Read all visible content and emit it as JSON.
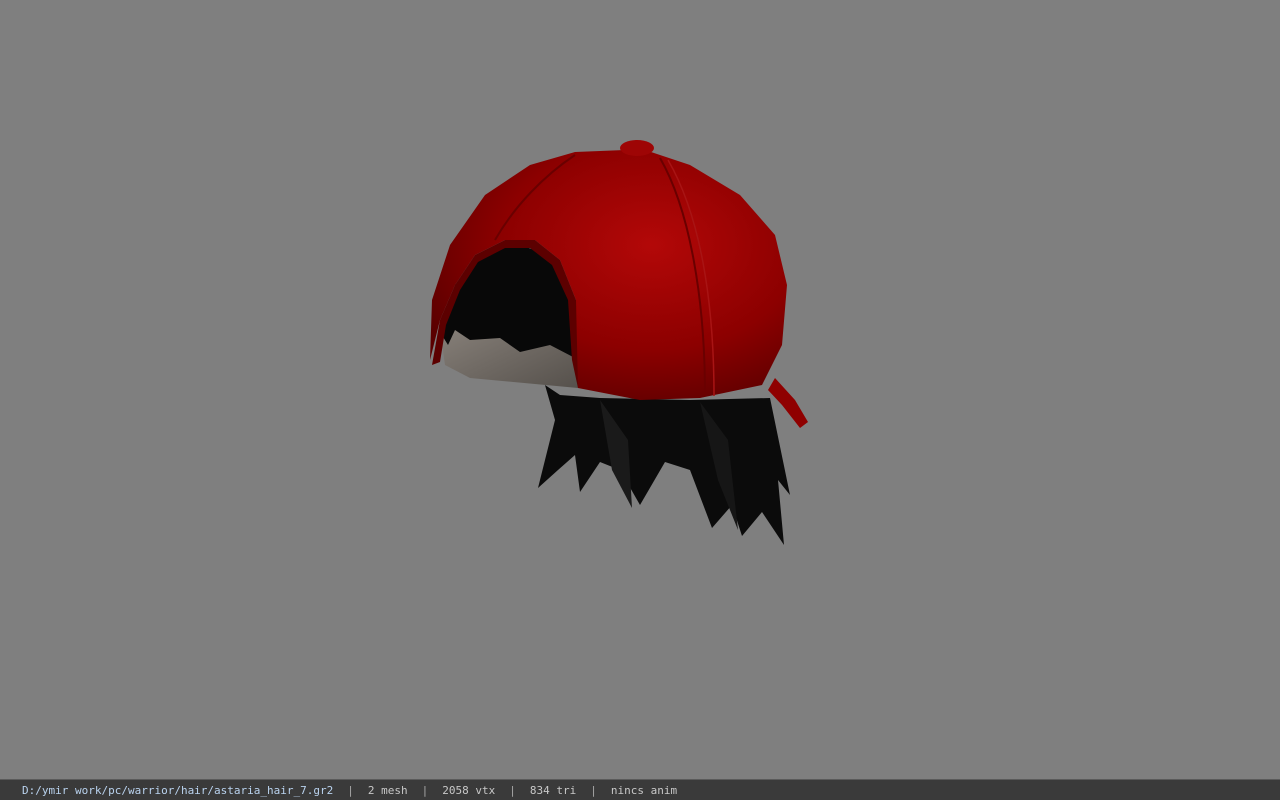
{
  "viewport": {
    "background_color": "#7f7f7f",
    "model_icon": "cap-with-hair-model",
    "colors": {
      "cap": "#8a0000",
      "cap_highlight": "#b40a0a",
      "hair": "#0a0a0a",
      "scalp": "#6e6a66"
    }
  },
  "status_bar": {
    "file_path": "D:/ymir work/pc/warrior/hair/astaria_hair_7.gr2",
    "separator": "|",
    "mesh_count": "2 mesh",
    "vertex_count": "2058 vtx",
    "triangle_count": "834 tri",
    "animation": "nincs anim"
  }
}
